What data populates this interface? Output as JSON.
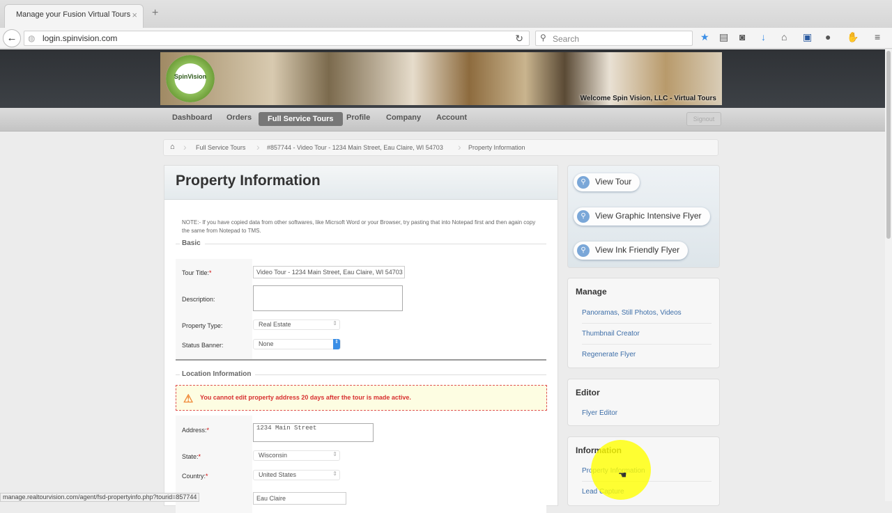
{
  "browser": {
    "tab_title": "Manage your Fusion Virtual Tours",
    "url": "login.spinvision.com",
    "search_placeholder": "Search",
    "status_url": "manage.realtourvision.com/agent/fsd-propertyinfo.php?tourid=857744"
  },
  "header": {
    "logo_text": "SpinVision",
    "welcome": "Welcome Spin Vision, LLC - Virtual Tours"
  },
  "menu": {
    "items": [
      "Dashboard",
      "Orders",
      "Full Service Tours",
      "Profile",
      "Company",
      "Account"
    ],
    "active": "Full Service Tours",
    "signout": "Signout"
  },
  "breadcrumb": [
    "Full Service Tours",
    "#857744 - Video Tour - 1234 Main Street, Eau Claire, WI 54703",
    "Property Information"
  ],
  "main": {
    "title": "Property Information",
    "note": "NOTE:- If you have copied data from other softwares, like Micrsoft Word or your Browser, try pasting that into Notepad first and then again copy the same from Notepad to TMS.",
    "basic": {
      "legend": "Basic",
      "tour_title_label": "Tour Title:",
      "tour_title": "Video Tour - 1234 Main Street, Eau Claire, WI 54703",
      "description_label": "Description:",
      "description": "",
      "property_type_label": "Property Type:",
      "property_type": "Real Estate",
      "status_banner_label": "Status Banner:",
      "status_banner": "None"
    },
    "location": {
      "legend": "Location Information",
      "warning": "You cannot edit property address 20 days after the tour is made active.",
      "address_label": "Address:",
      "address": "1234 Main Street",
      "state_label": "State:",
      "state": "Wisconsin",
      "country_label": "Country:",
      "country": "United States",
      "city": "Eau Claire"
    }
  },
  "sidebar": {
    "buttons": [
      "View Tour",
      "View Graphic Intensive Flyer",
      "View Ink Friendly Flyer"
    ],
    "manage": {
      "title": "Manage",
      "links": [
        "Panoramas, Still Photos, Videos",
        "Thumbnail Creator",
        "Regenerate Flyer"
      ]
    },
    "editor": {
      "title": "Editor",
      "links": [
        "Flyer Editor"
      ]
    },
    "information": {
      "title": "Information",
      "links": [
        "Property Information",
        "Lead Capture"
      ]
    }
  }
}
